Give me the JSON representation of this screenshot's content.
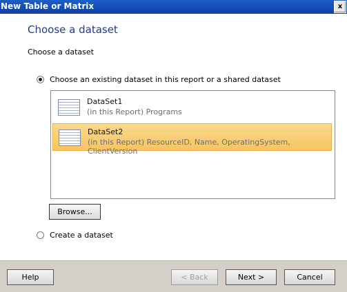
{
  "window": {
    "title": "New Table or Matrix",
    "close": "x"
  },
  "page": {
    "heading": "Choose a dataset",
    "subheading": "Choose a dataset"
  },
  "options": {
    "existing_label": "Choose an existing dataset in this report or a shared dataset",
    "create_label": "Create a dataset",
    "selected": "existing"
  },
  "datasets": [
    {
      "name": "DataSet1",
      "description": "(in this Report) Programs",
      "selected": false
    },
    {
      "name": "DataSet2",
      "description": "(in this Report) ResourceID, Name, OperatingSystem, ClientVersion",
      "selected": true
    }
  ],
  "browse_label": "Browse...",
  "buttons": {
    "help": "Help",
    "back": "< Back",
    "next": "Next >",
    "cancel": "Cancel"
  },
  "colors": {
    "heading": "#1f3c88",
    "selection": "#f7c460",
    "titlebar": "#0b3fa6"
  },
  "icons": {
    "dataset": "dataset-table-icon"
  }
}
